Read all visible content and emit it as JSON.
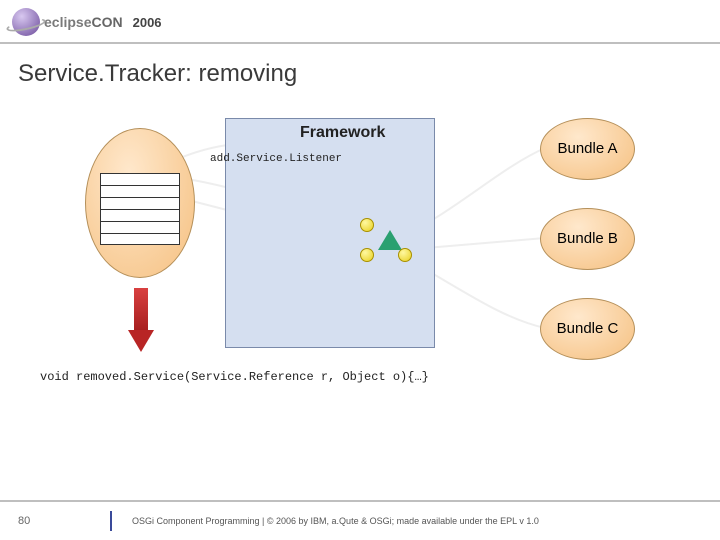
{
  "header": {
    "brand": "eclipse",
    "brand_con": "CON",
    "year": "2006"
  },
  "title": "Service.Tracker: removing",
  "diagram": {
    "framework_label": "Framework",
    "listener_label": "add.Service.Listener",
    "bundles": {
      "a": "Bundle A",
      "b": "Bundle B",
      "c": "Bundle C"
    },
    "callback": "void removed.Service(Service.Reference r, Object o){…}"
  },
  "footer": {
    "page": "80",
    "text": "OSGi Component Programming  | © 2006 by IBM, a.Qute & OSGi; made available under the EPL v 1.0"
  }
}
